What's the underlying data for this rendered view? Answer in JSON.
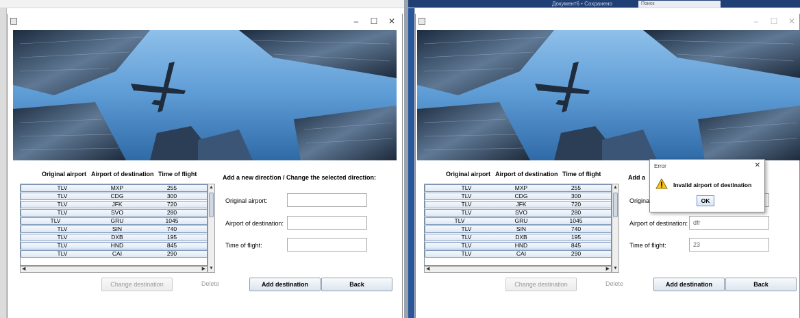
{
  "bg_window": {
    "left_caption": "",
    "right_caption": "Документ6 • Сохранено",
    "right_search": "Поиск"
  },
  "window": {
    "title": "",
    "minimize": "–",
    "maximize": "☐",
    "close": "✕"
  },
  "table": {
    "headers": [
      "Original airport",
      "Airport of destination",
      "Time of flight"
    ],
    "rows": [
      [
        "TLV",
        "MXP",
        "255"
      ],
      [
        "TLV",
        "CDG",
        "300"
      ],
      [
        "TLV",
        "JFK",
        "720"
      ],
      [
        "TLV",
        "SVO",
        "280"
      ],
      [
        "TLV",
        "GRU",
        "1045"
      ],
      [
        "TLV",
        "SIN",
        "740"
      ],
      [
        "TLV",
        "DXB",
        "195"
      ],
      [
        "TLV",
        "HND",
        "845"
      ],
      [
        "TLV",
        "CAI",
        "290"
      ]
    ]
  },
  "form": {
    "heading": "Add a new direction / Change the selected direction:",
    "heading_partial": "Add a",
    "original_airport_label": "Original airport:",
    "original_airport_label_partial": "Origina",
    "destination_label": "Airport of destination:",
    "time_label": "Time of flight:",
    "left_values": {
      "original": "",
      "destination": "",
      "time": ""
    },
    "right_values": {
      "original": "",
      "destination": "dfr",
      "time": "23"
    }
  },
  "buttons": {
    "change": "Change destination",
    "delete": "Delete",
    "add": "Add destination",
    "back": "Back"
  },
  "dialog": {
    "title": "Error",
    "message": "Invalid airport of destination",
    "ok": "OK",
    "close": "✕"
  },
  "colors": {
    "row_border": "#7f9bbf",
    "sky": "#4f8fcc",
    "dialog_ok_border": "#6f8fbf"
  }
}
